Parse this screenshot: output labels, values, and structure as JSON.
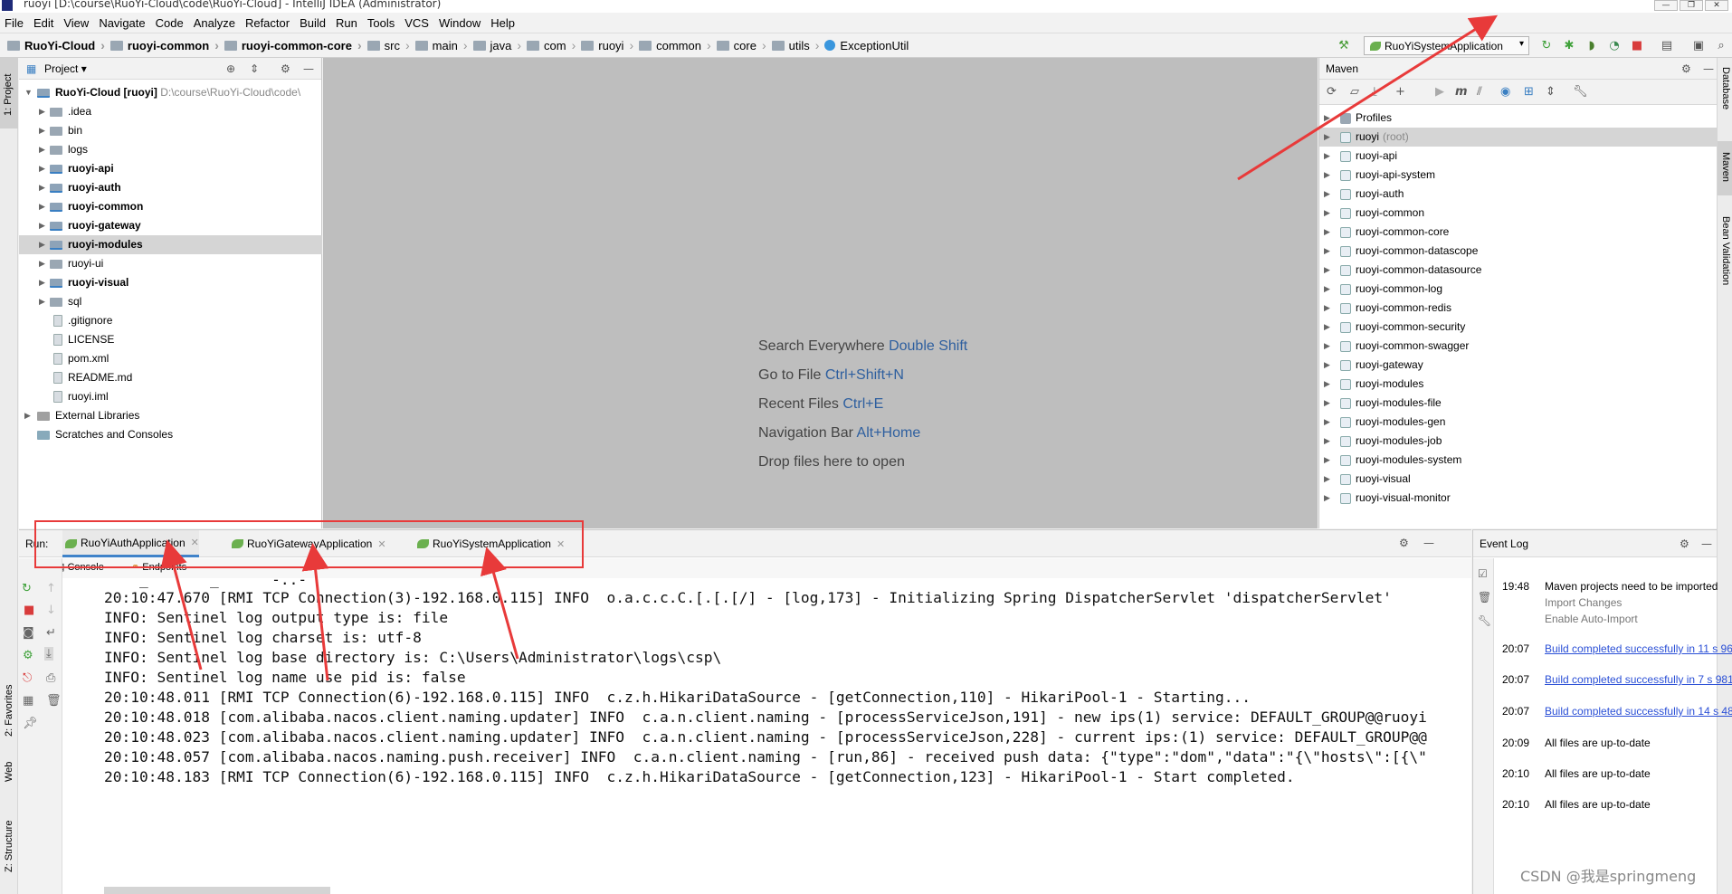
{
  "window": {
    "title": "ruoyi [D:\\course\\RuoYi-Cloud\\code\\RuoYi-Cloud] - IntelliJ IDEA (Administrator)",
    "controls": [
      "—",
      "❐",
      "✕"
    ]
  },
  "menu": [
    "File",
    "Edit",
    "View",
    "Navigate",
    "Code",
    "Analyze",
    "Refactor",
    "Build",
    "Run",
    "Tools",
    "VCS",
    "Window",
    "Help"
  ],
  "breadcrumbs": [
    "RuoYi-Cloud",
    "ruoyi-common",
    "ruoyi-common-core",
    "src",
    "main",
    "java",
    "com",
    "ruoyi",
    "common",
    "core",
    "utils",
    "ExceptionUtil"
  ],
  "run_config": "RuoYiSystemApplication",
  "left_stripe": {
    "project": "1: Project",
    "favorites": "2: Favorites",
    "web": "Web",
    "structure": "Z: Structure"
  },
  "right_stripe": {
    "database": "Database",
    "maven": "Maven",
    "bean": "Bean Validation"
  },
  "project_panel": {
    "title": "Project",
    "root": {
      "name": "RuoYi-Cloud [ruoyi]",
      "path": "D:\\course\\RuoYi-Cloud\\code\\"
    },
    "items": [
      {
        "label": ".idea",
        "bold": false,
        "type": "folder"
      },
      {
        "label": "bin",
        "bold": false,
        "type": "folder"
      },
      {
        "label": "logs",
        "bold": false,
        "type": "folder"
      },
      {
        "label": "ruoyi-api",
        "bold": true,
        "type": "module"
      },
      {
        "label": "ruoyi-auth",
        "bold": true,
        "type": "module"
      },
      {
        "label": "ruoyi-common",
        "bold": true,
        "type": "module"
      },
      {
        "label": "ruoyi-gateway",
        "bold": true,
        "type": "module"
      },
      {
        "label": "ruoyi-modules",
        "bold": true,
        "type": "module",
        "selected": true
      },
      {
        "label": "ruoyi-ui",
        "bold": false,
        "type": "folder"
      },
      {
        "label": "ruoyi-visual",
        "bold": true,
        "type": "module"
      },
      {
        "label": "sql",
        "bold": false,
        "type": "folder"
      },
      {
        "label": ".gitignore",
        "bold": false,
        "type": "file"
      },
      {
        "label": "LICENSE",
        "bold": false,
        "type": "file"
      },
      {
        "label": "pom.xml",
        "bold": false,
        "type": "file"
      },
      {
        "label": "README.md",
        "bold": false,
        "type": "file"
      },
      {
        "label": "ruoyi.iml",
        "bold": false,
        "type": "file"
      }
    ],
    "external_libraries": "External Libraries",
    "scratches": "Scratches and Consoles"
  },
  "editor_hints": [
    {
      "text": "Search Everywhere",
      "key": "Double Shift"
    },
    {
      "text": "Go to File",
      "key": "Ctrl+Shift+N"
    },
    {
      "text": "Recent Files",
      "key": "Ctrl+E"
    },
    {
      "text": "Navigation Bar",
      "key": "Alt+Home"
    },
    {
      "text": "Drop files here to open",
      "key": ""
    }
  ],
  "maven_panel": {
    "title": "Maven",
    "items": [
      {
        "label": "Profiles",
        "extra": ""
      },
      {
        "label": "ruoyi",
        "extra": "(root)"
      },
      {
        "label": "ruoyi-api",
        "extra": ""
      },
      {
        "label": "ruoyi-api-system",
        "extra": ""
      },
      {
        "label": "ruoyi-auth",
        "extra": ""
      },
      {
        "label": "ruoyi-common",
        "extra": ""
      },
      {
        "label": "ruoyi-common-core",
        "extra": ""
      },
      {
        "label": "ruoyi-common-datascope",
        "extra": ""
      },
      {
        "label": "ruoyi-common-datasource",
        "extra": ""
      },
      {
        "label": "ruoyi-common-log",
        "extra": ""
      },
      {
        "label": "ruoyi-common-redis",
        "extra": ""
      },
      {
        "label": "ruoyi-common-security",
        "extra": ""
      },
      {
        "label": "ruoyi-common-swagger",
        "extra": ""
      },
      {
        "label": "ruoyi-gateway",
        "extra": ""
      },
      {
        "label": "ruoyi-modules",
        "extra": ""
      },
      {
        "label": "ruoyi-modules-file",
        "extra": ""
      },
      {
        "label": "ruoyi-modules-gen",
        "extra": ""
      },
      {
        "label": "ruoyi-modules-job",
        "extra": ""
      },
      {
        "label": "ruoyi-modules-system",
        "extra": ""
      },
      {
        "label": "ruoyi-visual",
        "extra": ""
      },
      {
        "label": "ruoyi-visual-monitor",
        "extra": ""
      }
    ]
  },
  "run_panel": {
    "label": "Run:",
    "tabs": [
      "RuoYiAuthApplication",
      "RuoYiGatewayApplication",
      "RuoYiSystemApplication"
    ],
    "subtabs": [
      "Console",
      "Endpoints"
    ],
    "console_lines": [
      "  ''_'    `'_'    `-..-'",
      "20:10:47.670 [RMI TCP Connection(3)-192.168.0.115] INFO  o.a.c.c.C.[.[.[/] - [log,173] - Initializing Spring DispatcherServlet 'dispatcherServlet'",
      "INFO: Sentinel log output type is: file",
      "INFO: Sentinel log charset is: utf-8",
      "INFO: Sentinel log base directory is: C:\\Users\\Administrator\\logs\\csp\\",
      "INFO: Sentinel log name use pid is: false",
      "20:10:48.011 [RMI TCP Connection(6)-192.168.0.115] INFO  c.z.h.HikariDataSource - [getConnection,110] - HikariPool-1 - Starting...",
      "20:10:48.018 [com.alibaba.nacos.client.naming.updater] INFO  c.a.n.client.naming - [processServiceJson,191] - new ips(1) service: DEFAULT_GROUP@@ruoyi",
      "20:10:48.023 [com.alibaba.nacos.client.naming.updater] INFO  c.a.n.client.naming - [processServiceJson,228] - current ips:(1) service: DEFAULT_GROUP@@",
      "20:10:48.057 [com.alibaba.nacos.naming.push.receiver] INFO  c.a.n.client.naming - [run,86] - received push data: {\"type\":\"dom\",\"data\":\"{\\\"hosts\\\":[{\\\"",
      "20:10:48.183 [RMI TCP Connection(6)-192.168.0.115] INFO  c.z.h.HikariDataSource - [getConnection,123] - HikariPool-1 - Start completed."
    ]
  },
  "event_log": {
    "title": "Event Log",
    "entries": [
      {
        "time": "19:48",
        "text": "Maven projects need to be imported",
        "link": false,
        "actions": [
          "Import Changes",
          "Enable Auto-Import"
        ]
      },
      {
        "time": "20:07",
        "text": "Build completed successfully in 11 s 96",
        "link": true,
        "actions": []
      },
      {
        "time": "20:07",
        "text": "Build completed successfully in 7 s 981",
        "link": true,
        "actions": []
      },
      {
        "time": "20:07",
        "text": "Build completed successfully in 14 s 48",
        "link": true,
        "actions": []
      },
      {
        "time": "20:09",
        "text": "All files are up-to-date",
        "link": false,
        "actions": []
      },
      {
        "time": "20:10",
        "text": "All files are up-to-date",
        "link": false,
        "actions": []
      },
      {
        "time": "20:10",
        "text": "All files are up-to-date",
        "link": false,
        "actions": []
      }
    ]
  },
  "watermark": "CSDN @我是springmeng",
  "annotation_color": "#e83a3a"
}
